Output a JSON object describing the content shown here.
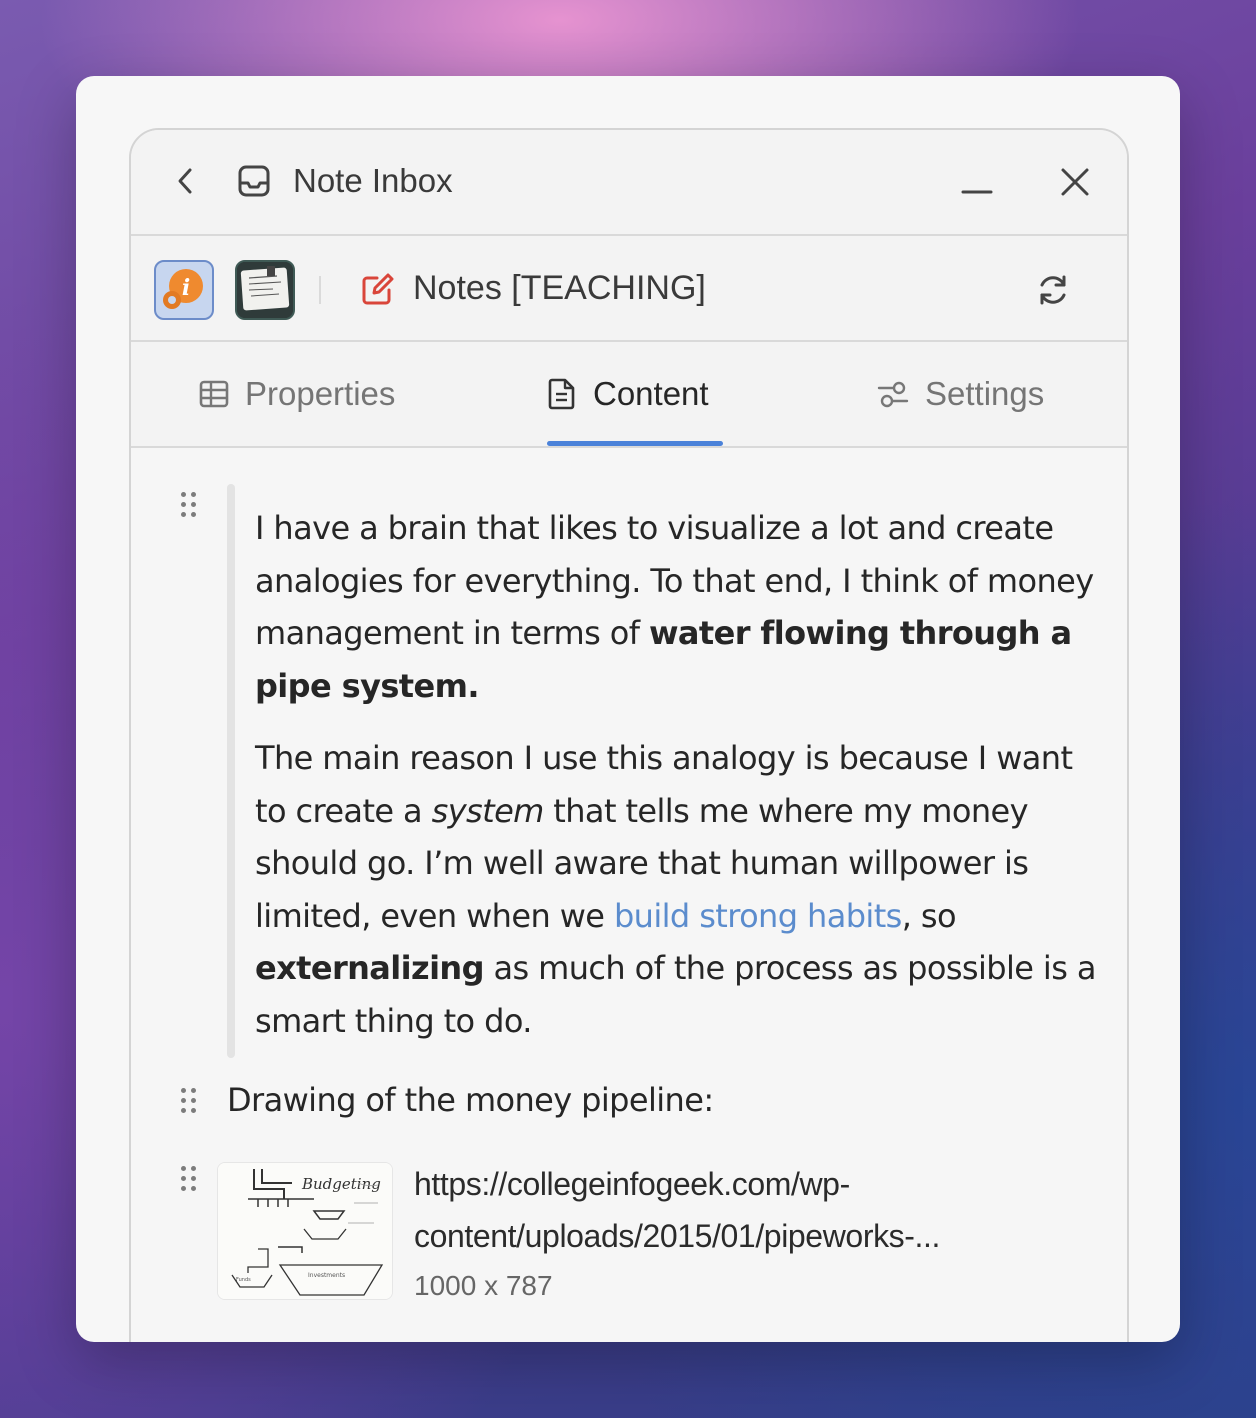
{
  "window": {
    "title": "Note Inbox"
  },
  "header": {
    "note_title": "Notes [TEACHING]"
  },
  "tabs": [
    {
      "label": "Properties",
      "active": false
    },
    {
      "label": "Content",
      "active": true
    },
    {
      "label": "Settings",
      "active": false
    }
  ],
  "content": {
    "para1": {
      "text_a": "I have a brain that likes to visualize a lot and create analogies for everything. To that end, I think of money management in terms of ",
      "bold": "water flowing through a pipe system."
    },
    "para2": {
      "text_a": "The main reason I use this analogy is because I want to create a ",
      "italic": "system",
      "text_b": " that tells me where my money should go. I’m well aware that human willpower is limited, even when we ",
      "link": "build strong habits",
      "text_c": ", so ",
      "bold": "externalizing",
      "text_d": " as much of the process as possible is a smart thing to do."
    },
    "drawing_label": "Drawing of the money pipeline:",
    "image": {
      "url_line1": "https://collegeinfogeek.com/wp-",
      "url_line2": "content/uploads/2015/01/pipeworks-...",
      "dimensions": "1000 x 787",
      "thumb_title": "Budgeting"
    }
  },
  "colors": {
    "accent": "#4b82d9",
    "link": "#5b8ccd",
    "edit_icon": "#d9453a"
  }
}
